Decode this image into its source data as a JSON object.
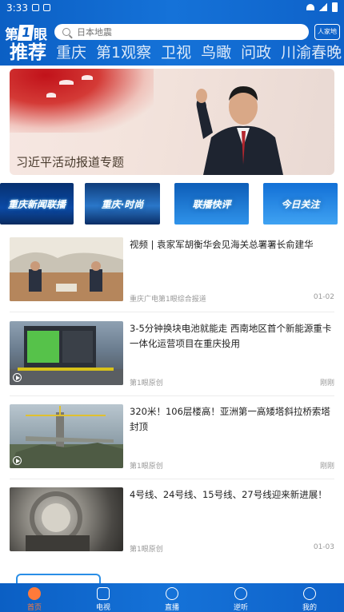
{
  "status": {
    "time": "3:33"
  },
  "header": {
    "logo_a": "第",
    "logo_b": "1",
    "logo_c": "眼",
    "search_placeholder": "日本地震",
    "right_badge": "人家地"
  },
  "tabs": [
    "推荐",
    "重庆",
    "第1观察",
    "卫视",
    "鸟瞰",
    "问政",
    "川渝春晚"
  ],
  "banner": {
    "title": "习近平活动报道专题"
  },
  "tiles": [
    {
      "label": "重庆新闻联播",
      "bg": "#0b3a86"
    },
    {
      "label": "重庆·时尚",
      "bg": "#1f5fb0"
    },
    {
      "label": "联播快评",
      "bg": "#1a7fd8"
    },
    {
      "label": "今日关注",
      "bg": "#1c86e6"
    }
  ],
  "news": [
    {
      "title": "视频 | 袁家军胡衡华会见海关总署署长俞建华",
      "source": "重庆广电第1眼综合报道",
      "time": "01-02",
      "video": false
    },
    {
      "title": "3-5分钟换块电池就能走 西南地区首个新能源重卡一体化运营项目在重庆投用",
      "source": "第1眼原创",
      "time": "刚刚",
      "video": true
    },
    {
      "title": "320米！106层楼高！亚洲第一高矮塔斜拉桥索塔封顶",
      "source": "第1眼原创",
      "time": "刚刚",
      "video": true
    },
    {
      "title": "4号线、24号线、15号线、27号线迎来新进展！",
      "source": "第1眼原创",
      "time": "01-03",
      "video": false
    }
  ],
  "nav": [
    {
      "label": "首页",
      "icon": "home-icon",
      "active": true
    },
    {
      "label": "电视",
      "icon": "tv-icon",
      "active": false
    },
    {
      "label": "直播",
      "icon": "live-icon",
      "active": false
    },
    {
      "label": "逆听",
      "icon": "radio-icon",
      "active": false
    },
    {
      "label": "我的",
      "icon": "profile-icon",
      "active": false
    }
  ],
  "colors": {
    "brand": "#1572d8",
    "active_nav": "#ff7a3a"
  }
}
